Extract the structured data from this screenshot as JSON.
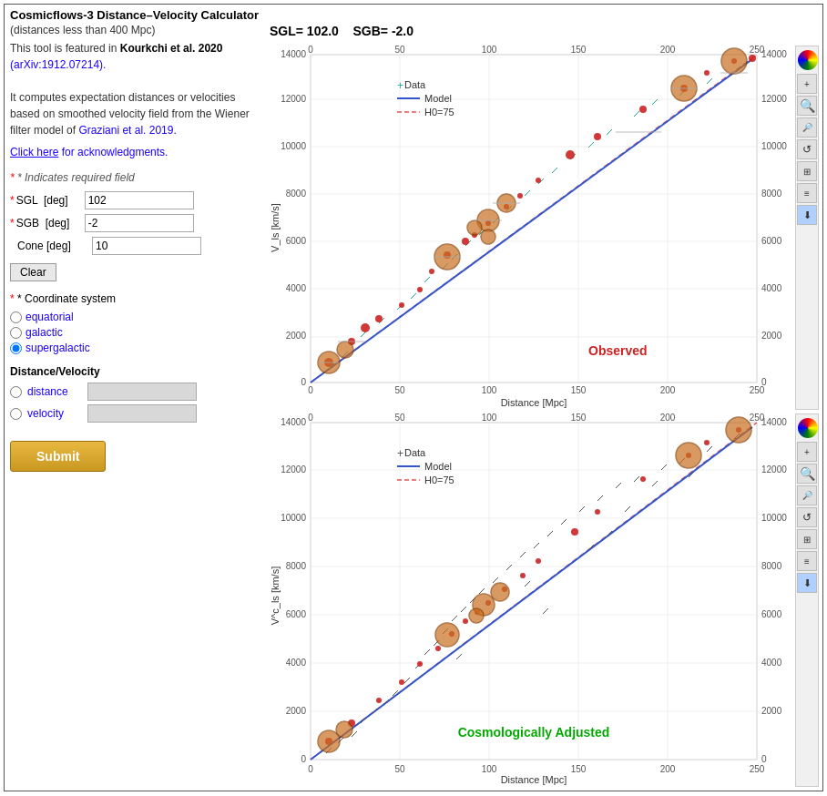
{
  "app": {
    "title": "Cosmicflows-3 Distance–Velocity Calculator",
    "subtitle": "(distances less than 400 Mpc)",
    "desc_part1": "This tool is featured in ",
    "desc_bold": "Kourkchi et al. 2020",
    "desc_arxiv_text": "(arXiv:1912.07214).",
    "desc_arxiv_link": "arXiv:1912.07214",
    "desc_part2": "It computes expectation distances or velocities based on smoothed velocity field from the Wiener filter model of ",
    "desc_link_text": "Graziani et al. 2019.",
    "acknowledgments_text": "Click here",
    "acknowledgments_suffix": " for acknowledgments.",
    "required_note": "* Indicates required field",
    "sgl_label": "* SGL  [deg]",
    "sgl_value": "102",
    "sgb_label": "* SGB  [deg]",
    "sgb_value": "-2",
    "cone_label": "Cone [deg]",
    "cone_value": "10",
    "clear_btn": "Clear",
    "coord_system_label": "* Coordinate system",
    "coord_equatorial": "equatorial",
    "coord_galactic": "galactic",
    "coord_supergalactic": "supergalactic",
    "coord_selected": "supergalactic",
    "dv_label": "Distance/Velocity",
    "distance_label": "distance",
    "velocity_label": "velocity",
    "submit_btn": "Submit",
    "sgl_header": "SGL=",
    "sgl_header_value": "102.0",
    "sgb_header": "SGB=",
    "sgb_header_value": "-2.0",
    "chart1_label_observed": "Observed",
    "chart2_label_cosmological": "Cosmologically Adjusted",
    "legend_data": "Data",
    "legend_model": "Model",
    "legend_h0": "H0=75",
    "x_axis_label": "Distance [Mpc]",
    "y_axis_label1": "V_ls [km/s]",
    "y_axis_label2": "V^c_ls [km/s]"
  },
  "toolbar_buttons": [
    {
      "name": "color-wheel",
      "symbol": "⊙"
    },
    {
      "name": "plus-icon",
      "symbol": "+"
    },
    {
      "name": "search-icon",
      "symbol": "🔍"
    },
    {
      "name": "search2-icon",
      "symbol": "🔎"
    },
    {
      "name": "reset-icon",
      "symbol": "↺"
    },
    {
      "name": "table-icon",
      "symbol": "⊞"
    },
    {
      "name": "list-icon",
      "symbol": "≡"
    },
    {
      "name": "download-icon",
      "symbol": "⬇"
    }
  ]
}
